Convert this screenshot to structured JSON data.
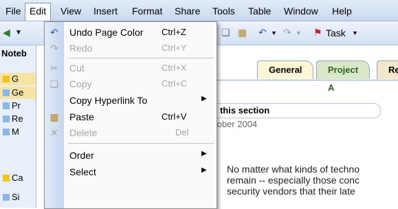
{
  "menubar": {
    "items": [
      "File",
      "Edit",
      "View",
      "Insert",
      "Format",
      "Share",
      "Tools",
      "Table",
      "Window",
      "Help"
    ]
  },
  "toolbar": {
    "task_label": "Task"
  },
  "left_pane": {
    "title": "Noteb",
    "items": [
      {
        "label": "G",
        "color": "#f0c419"
      },
      {
        "label": "Ge",
        "color": "#8bb7e6"
      },
      {
        "label": "Pr",
        "color": "#8bb7e6"
      },
      {
        "label": "Re",
        "color": "#8bb7e6"
      },
      {
        "label": "M",
        "color": "#8bb7e6"
      },
      {
        "label": "Ca",
        "color": "#f0c419"
      },
      {
        "label": "Si",
        "color": "#8bb7e6"
      }
    ]
  },
  "tabs": [
    "General",
    "Project A",
    "Re"
  ],
  "page": {
    "title": "t this section",
    "date": "tober 2004",
    "body_lines": [
      "No matter what kinds of techno",
      "remain -- especially those conc",
      "security vendors that their late"
    ]
  },
  "edit_menu": {
    "items": [
      {
        "label": "Undo Page Color",
        "shortcut": "Ctrl+Z",
        "icon": "undo-icon",
        "enabled": true
      },
      {
        "label": "Redo",
        "shortcut": "Ctrl+Y",
        "icon": "redo-icon",
        "enabled": false
      },
      {
        "label": "Cut",
        "shortcut": "Ctrl+X",
        "icon": "scissors-icon",
        "enabled": false
      },
      {
        "label": "Copy",
        "shortcut": "Ctrl+C",
        "icon": "copy-icon",
        "enabled": false
      },
      {
        "label": "Copy Hyperlink To",
        "shortcut": "",
        "icon": "",
        "enabled": true,
        "submenu": true
      },
      {
        "label": "Paste",
        "shortcut": "Ctrl+V",
        "icon": "paste-icon",
        "enabled": true
      },
      {
        "label": "Delete",
        "shortcut": "Del",
        "icon": "delete-x-icon",
        "enabled": false
      },
      {
        "label": "Order",
        "shortcut": "",
        "icon": "",
        "enabled": true,
        "submenu": true
      },
      {
        "label": "Select",
        "shortcut": "",
        "icon": "",
        "enabled": true,
        "submenu": true
      }
    ]
  },
  "colors": {
    "menubar_bg": "#d4e1f3",
    "tab_general": "#fff6d5",
    "tab_project_a": "#d9e9c8",
    "tab_re": "#f3e6c9"
  }
}
